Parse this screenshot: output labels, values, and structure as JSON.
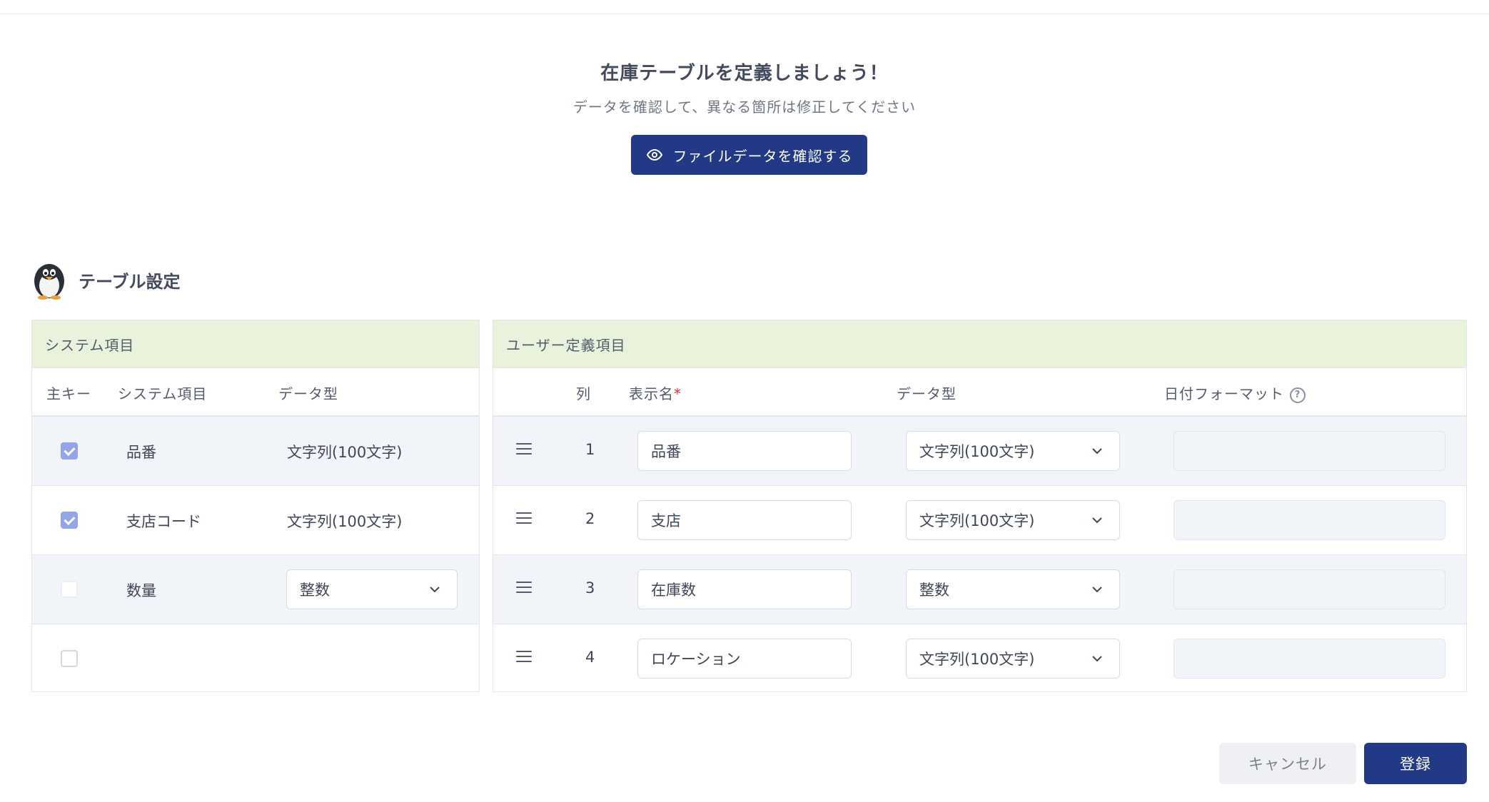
{
  "hero": {
    "title": "在庫テーブルを定義しましょう！",
    "subtitle": "データを確認して、異なる箇所は修正してください",
    "file_button": "ファイルデータを確認する"
  },
  "section": {
    "title": "テーブル設定"
  },
  "system_panel": {
    "header": "システム項目",
    "columns": [
      "主キー",
      "システム項目",
      "データ型"
    ],
    "rows": [
      {
        "checked": true,
        "name": "品番",
        "type": "文字列(100文字)",
        "type_editable": false
      },
      {
        "checked": true,
        "name": "支店コード",
        "type": "文字列(100文字)",
        "type_editable": false
      },
      {
        "checked": false,
        "name": "数量",
        "type": "整数",
        "type_editable": true
      },
      {
        "checked": false,
        "name": "",
        "type": "",
        "type_editable": false
      }
    ]
  },
  "user_panel": {
    "header": "ユーザー定義項目",
    "columns": {
      "col": "列",
      "display_name": "表示名",
      "required_mark": "*",
      "data_type": "データ型",
      "date_format": "日付フォーマット"
    },
    "rows": [
      {
        "col": "1",
        "display_name": "品番",
        "type": "文字列(100文字)",
        "date_format": ""
      },
      {
        "col": "2",
        "display_name": "支店",
        "type": "文字列(100文字)",
        "date_format": ""
      },
      {
        "col": "3",
        "display_name": "在庫数",
        "type": "整数",
        "date_format": ""
      },
      {
        "col": "4",
        "display_name": "ロケーション",
        "type": "文字列(100文字)",
        "date_format": ""
      }
    ]
  },
  "footer": {
    "cancel": "キャンセル",
    "submit": "登録"
  },
  "colors": {
    "primary": "#223a86",
    "panel_header": "#e9f3dc",
    "checkbox": "#93a5e8",
    "required": "#e03131"
  },
  "icons": {
    "file_button": "eye-icon",
    "help": "help-circle-icon",
    "drag": "drag-handle-icon",
    "dropdown": "chevron-down-icon",
    "section": "penguin-icon"
  }
}
